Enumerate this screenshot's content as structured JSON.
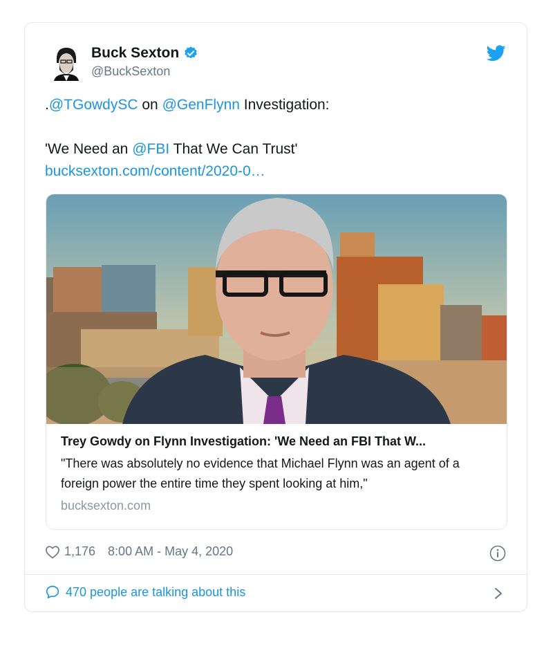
{
  "author": {
    "display_name": "Buck Sexton",
    "handle": "@BuckSexton"
  },
  "tweet": {
    "line1": {
      "prefix": ".",
      "mention1": "@TGowdySC",
      "middle": " on ",
      "mention2": "@GenFlynn",
      "suffix": " Investigation:"
    },
    "line2": {
      "prefix": "'We Need an ",
      "mention": "@FBI",
      "suffix": " That We Can Trust'"
    },
    "link": "bucksexton.com/content/2020-0…"
  },
  "card": {
    "title": "Trey Gowdy on Flynn Investigation: 'We Need an FBI That W...",
    "description": "\"There was absolutely no evidence that Michael Flynn was an agent of a foreign power the entire time they spent looking at him,\"",
    "domain": "bucksexton.com"
  },
  "meta": {
    "likes": "1,176",
    "timestamp": "8:00 AM - May 4, 2020"
  },
  "footer": {
    "talking": "470 people are talking about this"
  },
  "colors": {
    "accent": "#1b95e0",
    "secondary_text": "#657786",
    "border": "#e1e8ed"
  },
  "icons": {
    "verified": "verified-badge-icon",
    "brand": "twitter-bird-icon",
    "like": "heart-icon",
    "info": "info-icon",
    "reply": "speech-bubble-icon",
    "more": "chevron-right-icon"
  }
}
